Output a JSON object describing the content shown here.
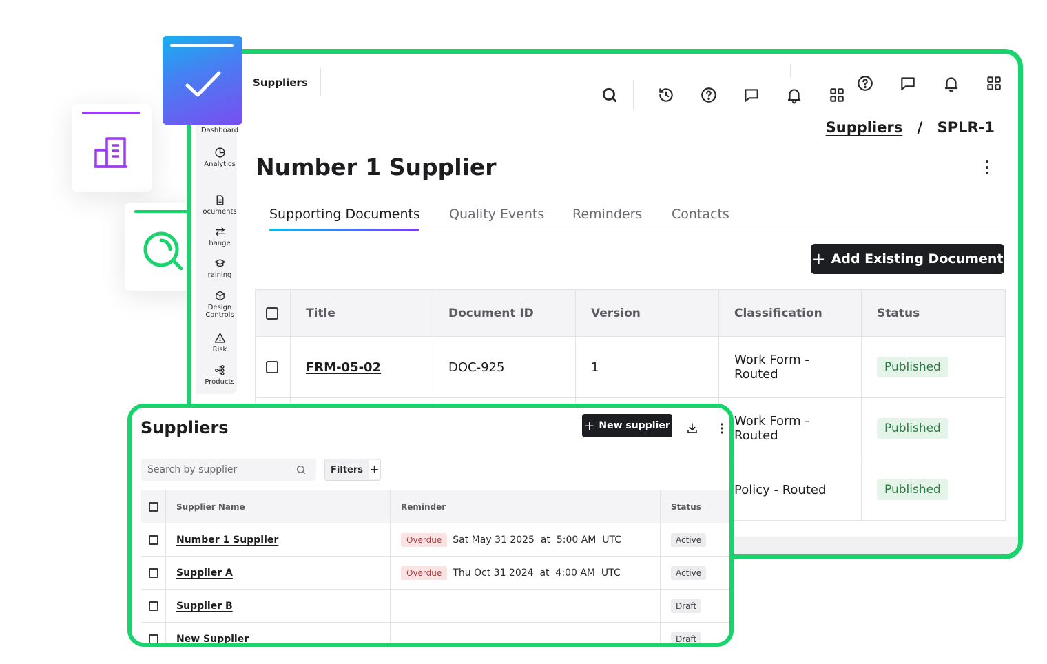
{
  "header": {
    "title": "Suppliers",
    "icons": [
      "search-icon",
      "history-icon",
      "help-icon",
      "chat-icon",
      "bell-icon",
      "apps-grid-icon"
    ]
  },
  "sidebar": {
    "items": [
      {
        "label": "Dashboard",
        "icon": "dashboard-icon"
      },
      {
        "label": "Analytics",
        "icon": "pie-chart-icon"
      },
      {
        "label": "ocuments",
        "icon": "document-icon"
      },
      {
        "label": "hange",
        "icon": "swap-arrows-icon"
      },
      {
        "label": "raining",
        "icon": "graduation-cap-icon"
      },
      {
        "label": "Design",
        "label2": "Controls",
        "icon": "cube-icon"
      },
      {
        "label": "Risk",
        "icon": "warning-triangle-icon"
      },
      {
        "label": "Products",
        "icon": "product-tree-icon"
      }
    ]
  },
  "breadcrumb": {
    "parent": "Suppliers",
    "separator": "/",
    "current": "SPLR-1"
  },
  "page": {
    "title": "Number 1 Supplier",
    "tabs": [
      {
        "label": "Supporting Documents",
        "active": true
      },
      {
        "label": "Quality Events",
        "active": false
      },
      {
        "label": "Reminders",
        "active": false
      },
      {
        "label": "Contacts",
        "active": false
      }
    ],
    "add_button": {
      "plus": "+",
      "label": "Add Existing Document"
    }
  },
  "documents": {
    "columns": [
      "Title",
      "Document ID",
      "Version",
      "Classification",
      "Status"
    ],
    "rows": [
      {
        "title": "FRM-05-02",
        "doc_id": "DOC-925",
        "version": "1",
        "classification": "Work Form -",
        "classification2": "Routed",
        "status": "Published"
      },
      {
        "title": "",
        "doc_id": "",
        "version": "",
        "classification": "Work Form -",
        "classification2": "Routed",
        "status": "Published"
      },
      {
        "title": "",
        "doc_id": "",
        "version": "",
        "classification": "Policy - Routed",
        "classification2": "",
        "status": "Published"
      }
    ]
  },
  "supplier_list": {
    "title": "Suppliers",
    "new_button": {
      "plus": "+",
      "label": "New supplier"
    },
    "search_placeholder": "Search by supplier",
    "filters_label": "Filters",
    "filters_plus": "+",
    "columns": [
      "Supplier Name",
      "Reminder",
      "Status"
    ],
    "rows": [
      {
        "name": "Number 1 Supplier",
        "reminder_badge": "Overdue",
        "reminder": "Sat May 31 2025  at  5:00 AM  UTC",
        "status": "Active"
      },
      {
        "name": "Supplier A",
        "reminder_badge": "Overdue",
        "reminder": "Thu Oct 31 2024  at  4:00 AM  UTC",
        "status": "Active"
      },
      {
        "name": "Supplier B",
        "reminder_badge": "",
        "reminder": "",
        "status": "Draft"
      },
      {
        "name": "New Supplier",
        "reminder_badge": "",
        "reminder": "",
        "status": "Draft"
      }
    ]
  },
  "colors": {
    "frame_green": "#19d46c",
    "purple": "#9b3cf0",
    "gradient_start": "#0fb8e8",
    "gradient_end": "#7a3cf0",
    "dark_button": "#1d1e21"
  }
}
